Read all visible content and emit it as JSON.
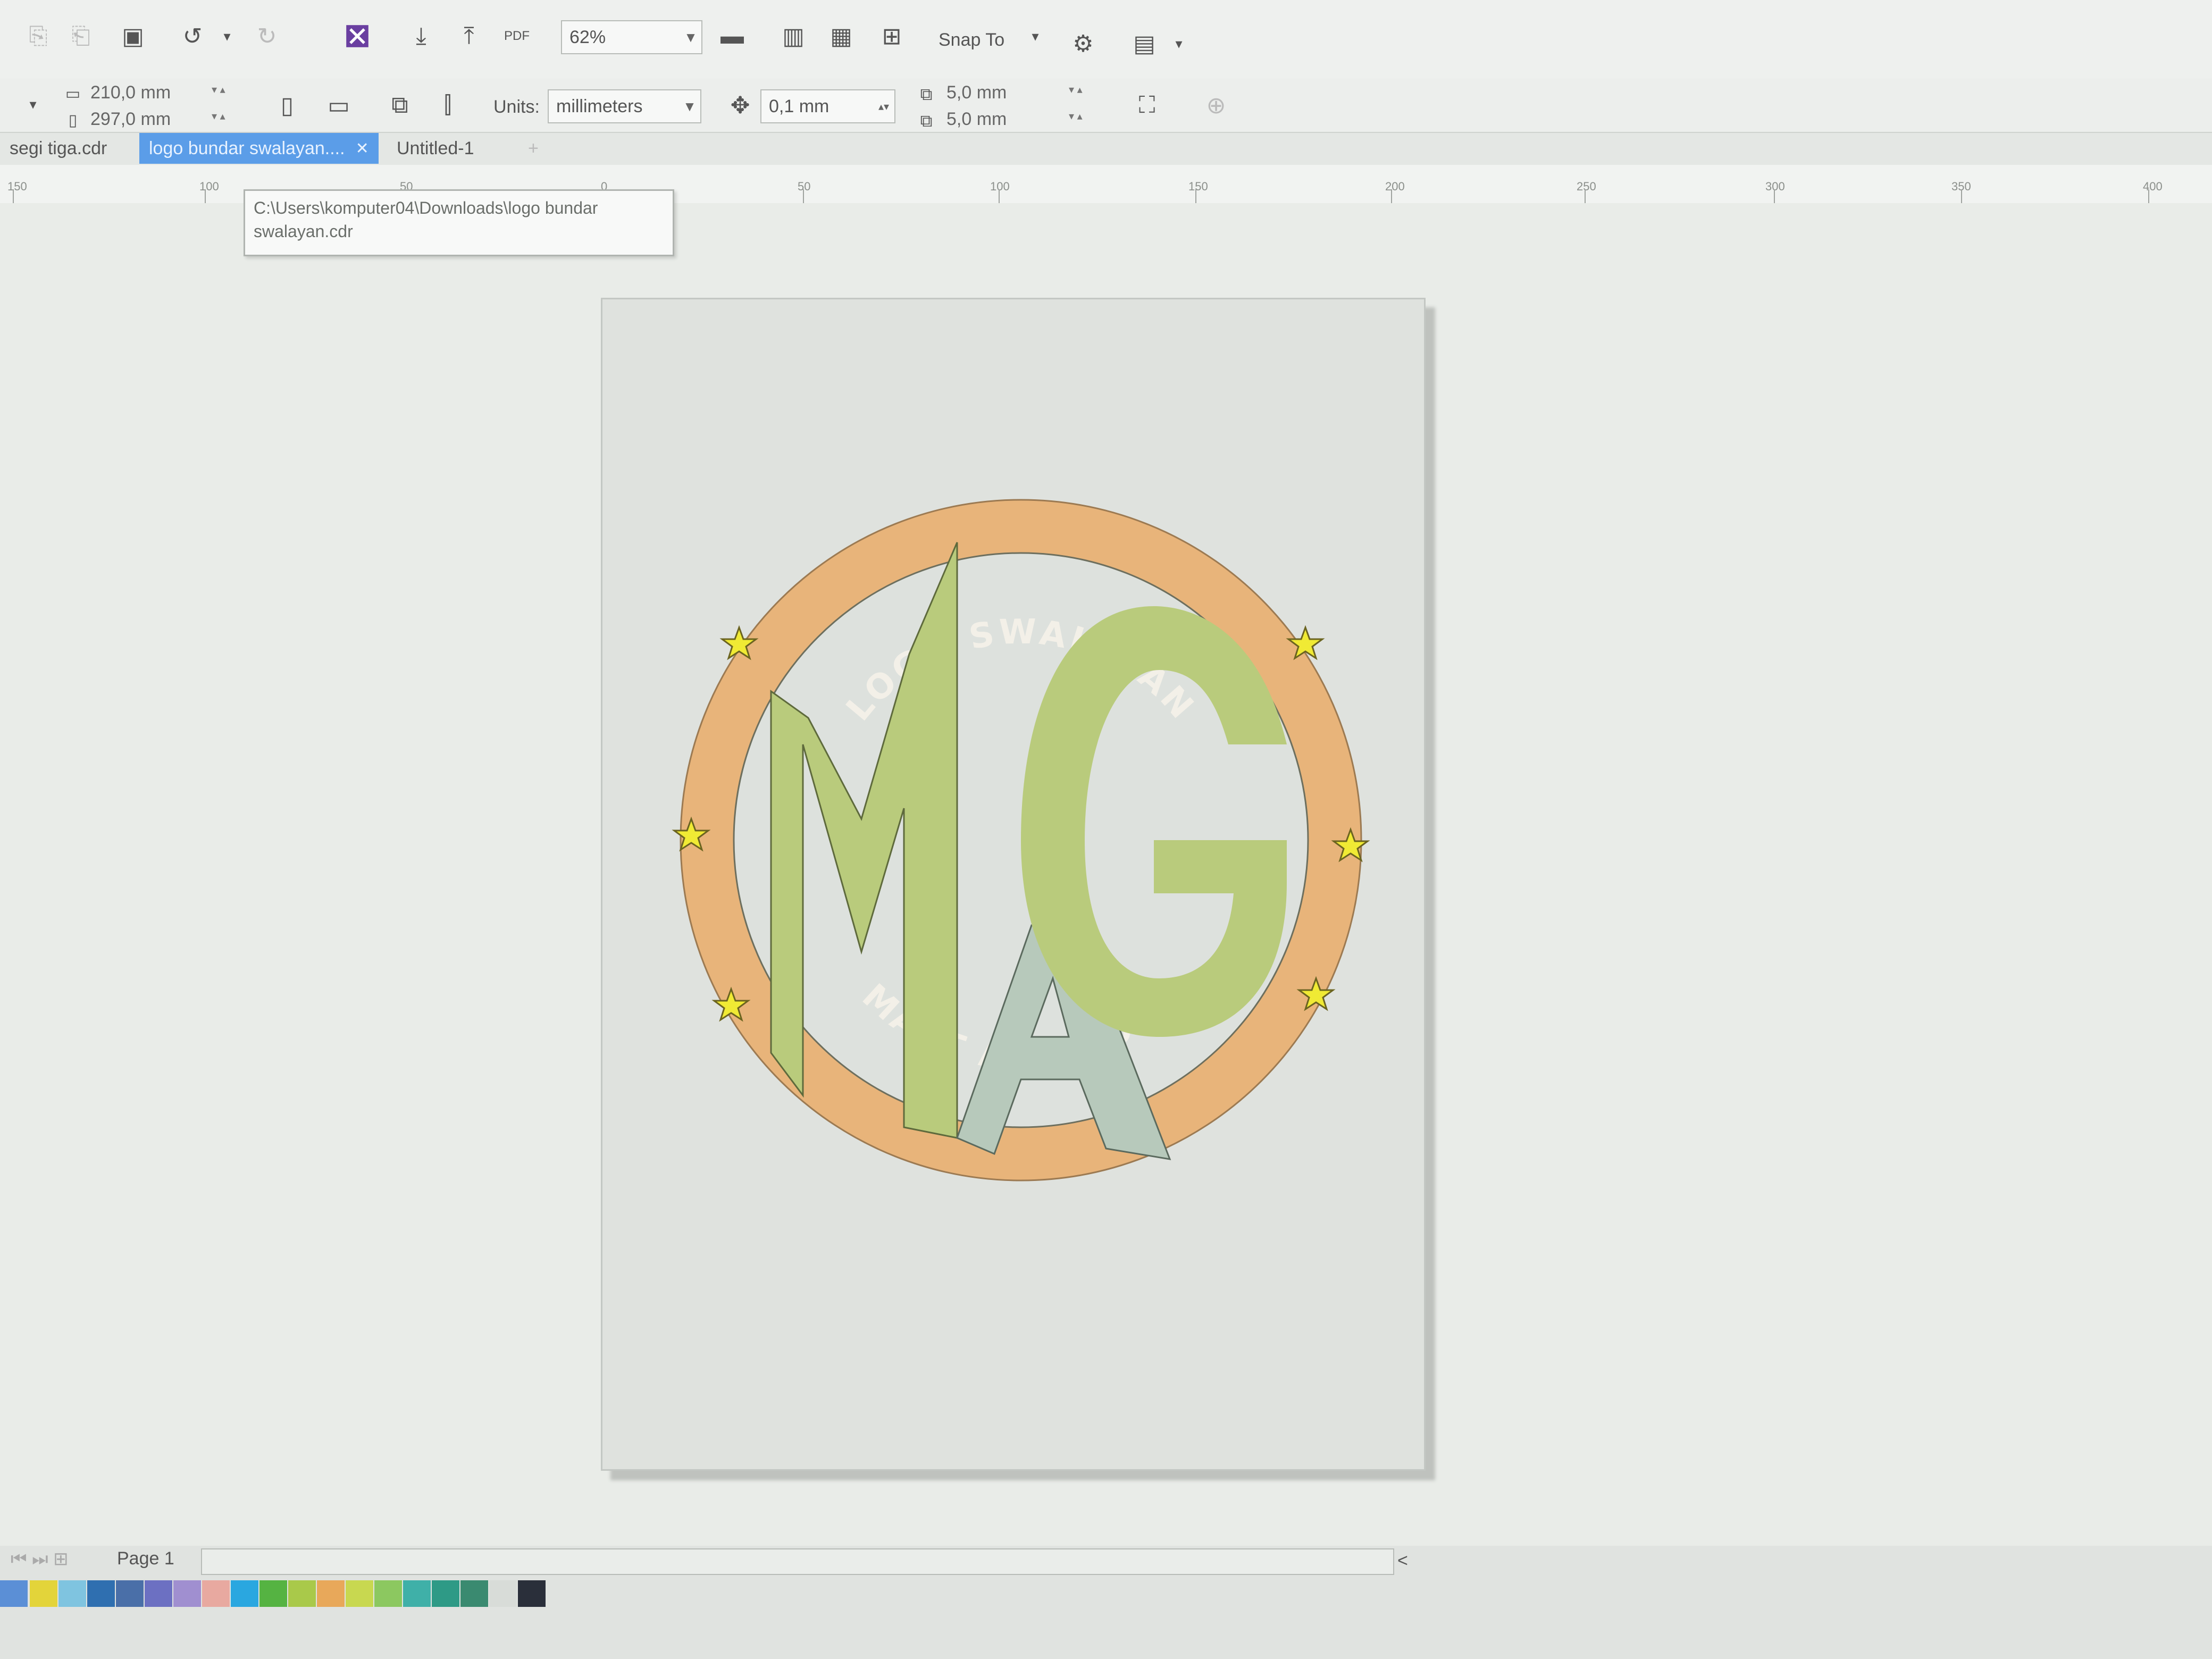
{
  "toolbar": {
    "zoom_value": "62%",
    "snap_to_label": "Snap To"
  },
  "property_bar": {
    "page_width": "210,0 mm",
    "page_height": "297,0 mm",
    "units_label": "Units:",
    "units_value": "millimeters",
    "nudge_value": "0,1 mm",
    "duplicate_x": "5,0 mm",
    "duplicate_y": "5,0 mm"
  },
  "tabs": [
    {
      "label": "segi tiga.cdr",
      "active": false
    },
    {
      "label": "logo bundar swalayan....",
      "active": true
    },
    {
      "label": "Untitled-1",
      "active": false
    }
  ],
  "ruler": {
    "ticks": [
      "150",
      "100",
      "50",
      "0",
      "50",
      "100",
      "150",
      "200",
      "250",
      "300",
      "350",
      "400"
    ]
  },
  "tooltip": {
    "line1": "C:\\Users\\komputer04\\Downloads\\logo bundar",
    "line2": "swalayan.cdr"
  },
  "logo": {
    "top_text": "LOGO SWALAYAN",
    "bottom_text": "MART ASH GOLD",
    "letters": [
      "M",
      "A",
      "G"
    ],
    "ring_color": "#e8b47a",
    "green": "#b9cb7c",
    "sage": "#b7c9bb",
    "star_color": "#f0ea34"
  },
  "status": {
    "page_tab": "Page 1"
  },
  "palette": [
    "#5b8fd6",
    "#e3d43a",
    "#7fc4e0",
    "#2f6fb0",
    "#4a6fa8",
    "#6c70c2",
    "#a08fd0",
    "#e8a9a0",
    "#2aa7e0",
    "#55b342",
    "#a9c94a",
    "#e8a85a",
    "#c8d850",
    "#8cc860",
    "#3fb0a8",
    "#2e9a86",
    "#3a8a70",
    "#d8dcd8",
    "#2a2f3a"
  ]
}
